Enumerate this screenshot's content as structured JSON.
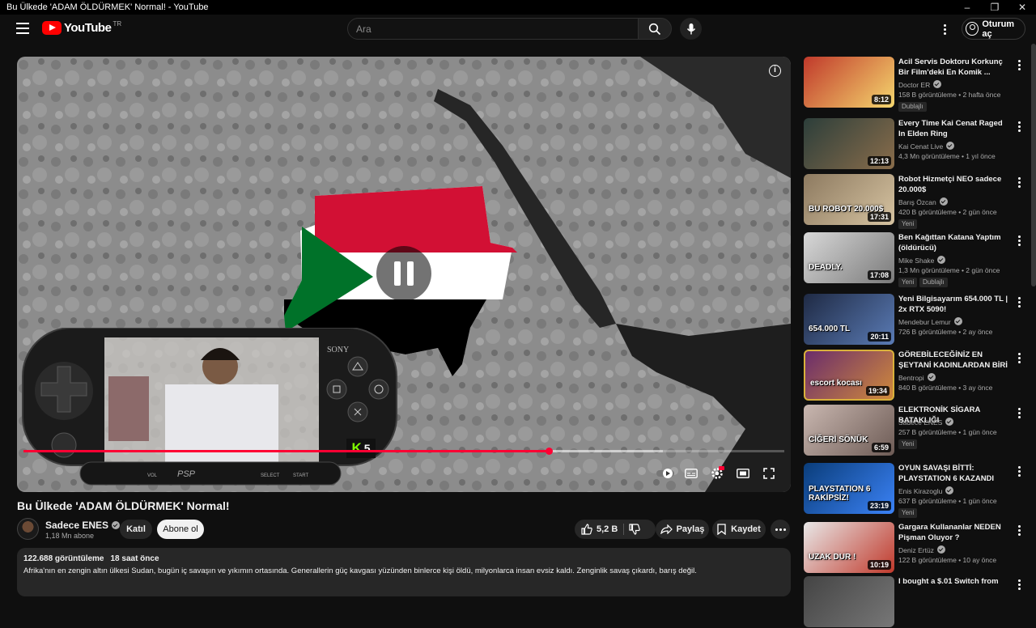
{
  "window": {
    "title": "Bu Ülkede 'ADAM ÖLDÜRMEK' Normal! - YouTube",
    "controls": [
      "–",
      "❐",
      "✕"
    ]
  },
  "masthead": {
    "logo_text": "YouTube",
    "country_code": "TR",
    "search_placeholder": "Ara",
    "signin_label": "Oturum aç"
  },
  "player": {
    "progress_played_fraction": 0.69,
    "progress_loaded_fraction": 0.84,
    "watermark_letter": "K",
    "watermark_number": "5",
    "psp": {
      "brand": "SONY",
      "model": "PSP",
      "vol_label": "VOL",
      "select_label": "SELECT",
      "start_label": "START"
    }
  },
  "video": {
    "title": "Bu Ülkede 'ADAM ÖLDÜRMEK' Normal!",
    "channel_name": "Sadece ENES",
    "subscribers": "1,18 Mn abone",
    "join_label": "Katıl",
    "subscribe_label": "Abone ol",
    "likes": "5,2 B",
    "share_label": "Paylaş",
    "save_label": "Kaydet"
  },
  "description": {
    "views": "122.688 görüntüleme",
    "time": "18 saat önce",
    "text": "Afrika'nın en zengin altın ülkesi Sudan, bugün iç savaşın ve yıkımın ortasında. Generallerin güç kavgası yüzünden binlerce kişi öldü, milyonlarca insan evsiz kaldı. Zenginlik savaş çıkardı, barış değil."
  },
  "recommendations": [
    {
      "title": "Acil Servis Doktoru Korkunç Bir Film'deki En Komik ...",
      "channel": "Doctor ER",
      "meta": "158 B görüntüleme • 2 hafta önce",
      "duration": "8:12",
      "badge": "Dublajlı",
      "thumb_colors": [
        "#c0392b",
        "#f5d76e"
      ]
    },
    {
      "title": "Every Time Kai Cenat Raged In Elden Ring",
      "channel": "Kai Cenat Live",
      "meta": "4,3 Mn görüntüleme • 1 yıl önce",
      "duration": "12:13",
      "badge": "",
      "thumb_colors": [
        "#2c3e3a",
        "#8a6d4b"
      ]
    },
    {
      "title": "Robot Hizmetçi NEO sadece 20.000$",
      "channel": "Barış Özcan",
      "meta": "420 B görüntüleme • 2 gün önce",
      "duration": "17:31",
      "badge": "Yeni",
      "thumb_colors": [
        "#8d7a60",
        "#d6c3a1"
      ],
      "overlay": "BU ROBOT 20.000$"
    },
    {
      "title": "Ben Kağıttan Katana Yaptım (öldürücü)",
      "channel": "Mike Shake",
      "meta": "1,3 Mn görüntüleme • 2 gün önce",
      "duration": "17:08",
      "badge": "Yeni",
      "badge2": "Dublajlı",
      "thumb_colors": [
        "#d8d8d8",
        "#7a7a7a"
      ],
      "overlay": "DEADLY."
    },
    {
      "title": "Yeni Bilgisayarım 654.000 TL | 2x RTX 5090!",
      "channel": "Mendebur Lemur",
      "meta": "726 B görüntüleme • 2 ay önce",
      "duration": "20:11",
      "badge": "",
      "thumb_colors": [
        "#1f2a44",
        "#5a7bb5"
      ],
      "overlay": "654.000 TL"
    },
    {
      "title": "GÖREBİLECEĞİNİZ EN ŞEYTANİ KADINLARDAN BİRİ",
      "channel": "Bentropi",
      "meta": "840 B görüntüleme • 3 ay önce",
      "duration": "19:34",
      "badge": "",
      "thumb_colors": [
        "#6b2d6b",
        "#d08a3c"
      ],
      "overlay": "escort  kocası"
    },
    {
      "title": "ELEKTRONİK SİGARA BATAKLIĞI",
      "channel": "Sadece ENES",
      "meta": "257 B görüntüleme • 1 gün önce",
      "duration": "6:59",
      "badge": "Yeni",
      "thumb_colors": [
        "#c9b7b0",
        "#6d5b55"
      ],
      "overlay": "CİĞERİ SÖNÜK"
    },
    {
      "title": "OYUN SAVAŞI BİTTİ: PLAYSTATION 6 KAZANDI",
      "channel": "Enis Kirazoglu",
      "meta": "637 B görüntüleme • 1 gün önce",
      "duration": "23:19",
      "badge": "Yeni",
      "thumb_colors": [
        "#0a3d7a",
        "#3b82f6"
      ],
      "overlay": "PLAYSTATION 6 RAKİPSİZ!"
    },
    {
      "title": "Gargara Kullananlar NEDEN Pişman Oluyor ?",
      "channel": "Deniz Ertüz",
      "meta": "122 B görüntüleme • 10 ay önce",
      "duration": "10:19",
      "badge": "",
      "thumb_colors": [
        "#e8e8e8",
        "#c0392b"
      ],
      "overlay": "UZAK DUR !"
    },
    {
      "title": "I bought a $.01 Switch from",
      "channel": "",
      "meta": "",
      "duration": "",
      "badge": "",
      "thumb_colors": [
        "#444",
        "#777"
      ]
    }
  ]
}
